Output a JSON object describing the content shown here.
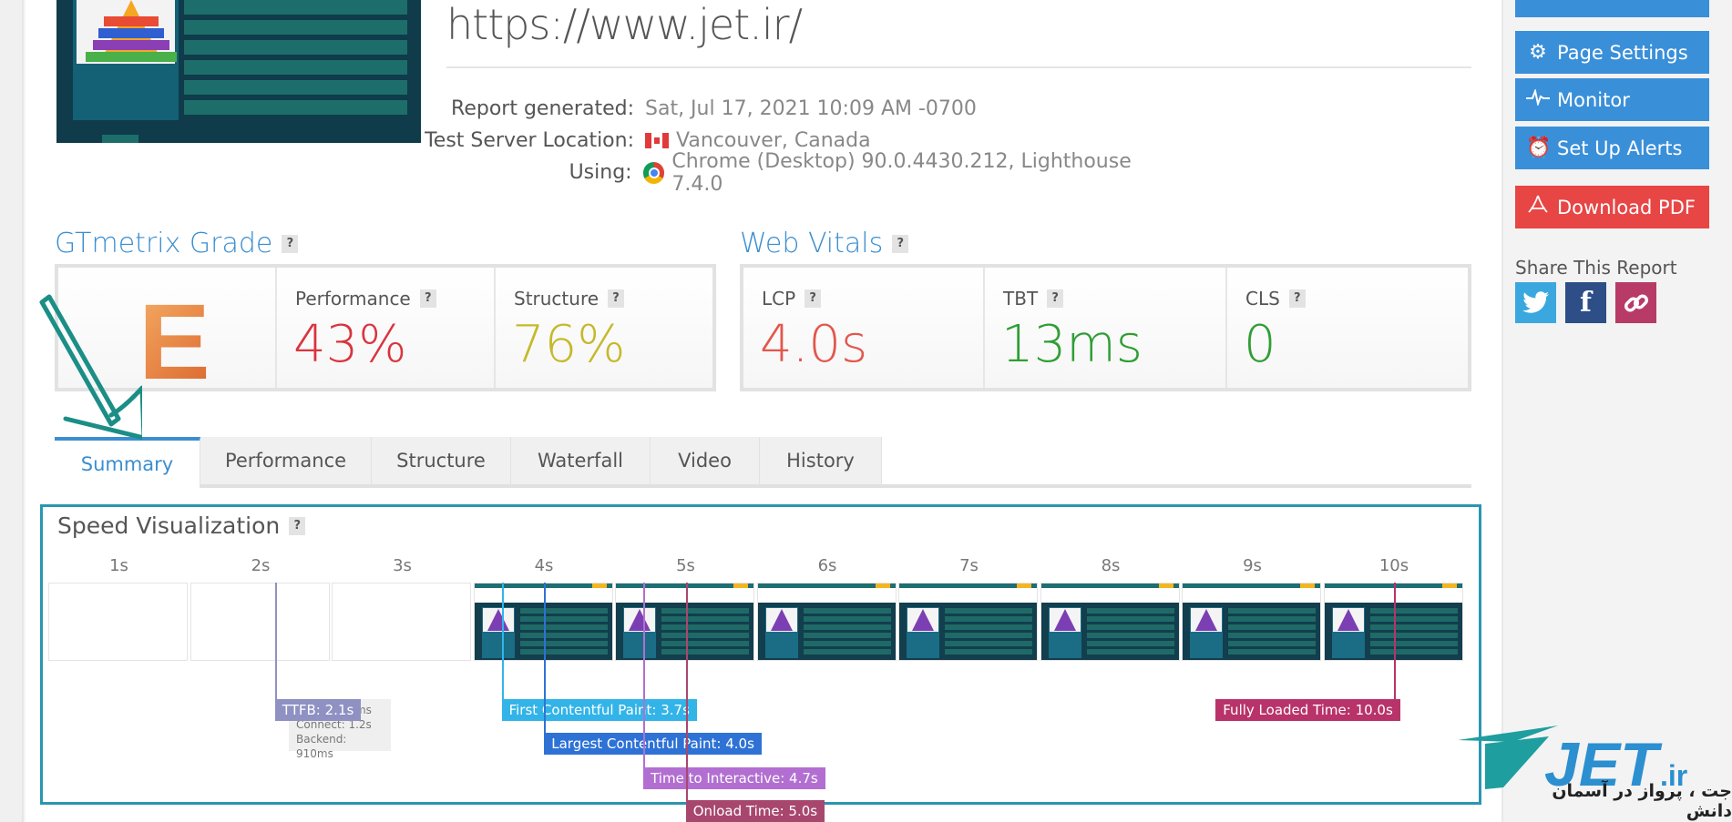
{
  "report": {
    "url": "https://www.jet.ir/",
    "meta": [
      {
        "label": "Report generated:",
        "value": "Sat, Jul 17, 2021 10:09 AM -0700",
        "icon": null
      },
      {
        "label": "Test Server Location:",
        "value": "Vancouver, Canada",
        "icon": "canada-flag-icon"
      },
      {
        "label": "Using:",
        "value": "Chrome (Desktop) 90.0.4430.212, Lighthouse 7.4.0",
        "icon": "chrome-icon"
      }
    ]
  },
  "sidebar": {
    "buttons": [
      {
        "label": "Page Settings",
        "icon": "gear-icon"
      },
      {
        "label": "Monitor",
        "icon": "pulse-icon"
      },
      {
        "label": "Set Up Alerts",
        "icon": "alarm-clock-icon"
      },
      {
        "label": "Download PDF",
        "icon": "pdf-icon"
      }
    ],
    "share_label": "Share This Report",
    "share": [
      "twitter",
      "facebook",
      "link"
    ]
  },
  "grade": {
    "title": "GTmetrix Grade",
    "letter": "E",
    "performance_label": "Performance",
    "performance_value": "43%",
    "structure_label": "Structure",
    "structure_value": "76%",
    "colors": {
      "performance": "#d9343e",
      "structure": "#c5b92a"
    }
  },
  "vitals": {
    "title": "Web Vitals",
    "items": [
      {
        "label": "LCP",
        "value": "4.0s",
        "color": "#e2574c"
      },
      {
        "label": "TBT",
        "value": "13ms",
        "color": "#2f9e35"
      },
      {
        "label": "CLS",
        "value": "0",
        "color": "#2f9e35"
      }
    ]
  },
  "tabs": [
    "Summary",
    "Performance",
    "Structure",
    "Waterfall",
    "Video",
    "History"
  ],
  "active_tab": "Summary",
  "speed": {
    "title": "Speed Visualization",
    "help": "?",
    "ticks": [
      "1s",
      "2s",
      "3s",
      "4s",
      "5s",
      "6s",
      "7s",
      "8s",
      "9s",
      "10s"
    ],
    "loaded_from_tick": 3,
    "markers": [
      {
        "label": "TTFB: 2.1s",
        "time": 2.1,
        "color": "#8e91c2"
      },
      {
        "label": "First Contentful Paint: 3.7s",
        "time": 3.7,
        "color": "#32b4e8"
      },
      {
        "label": "Largest Contentful Paint: 4.0s",
        "time": 4.0,
        "color": "#2e72d6"
      },
      {
        "label": "Time to Interactive: 4.7s",
        "time": 4.7,
        "color": "#b26fd1"
      },
      {
        "label": "Onload Time: 5.0s",
        "time": 5.0,
        "color": "#a8476e"
      },
      {
        "label": "Fully Loaded Time: 10.0s",
        "time": 10.0,
        "color": "#b8336a"
      }
    ],
    "ttfb_details": [
      "Redirect: 0ms",
      "Connect: 1.2s",
      "Backend: 910ms"
    ]
  },
  "watermark": {
    "brand": "JET.ir",
    "tagline": "جت ، پرواز در آسمان دانش"
  },
  "help_glyph": "?"
}
